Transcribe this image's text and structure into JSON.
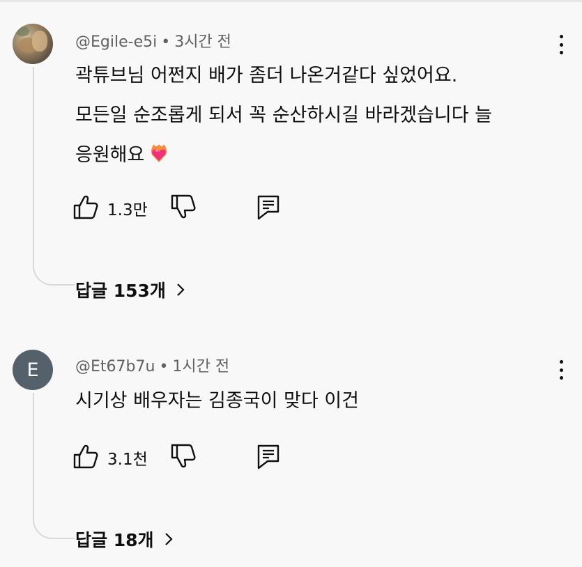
{
  "comments": [
    {
      "author": "@Egile-e5i",
      "separator": "•",
      "time": "3시간 전",
      "lines": [
        "곽튜브님 어쩐지 배가 좀더 나온거같다 싶었어요.",
        "모든일 순조롭게 되서 꼭 순산하시길 바라겠습니다 늘",
        "응원해요"
      ],
      "emoji": "heart-on-fire",
      "likes": "1.3만",
      "replies_label": "답글 153개",
      "avatar_type": "photo"
    },
    {
      "author": "@Et67b7u",
      "separator": "•",
      "time": "1시간 전",
      "lines": [
        "시기상 배우자는 김종국이 맞다 이건"
      ],
      "likes": "3.1천",
      "replies_label": "답글 18개",
      "avatar_type": "letter",
      "avatar_letter": "E",
      "avatar_color": "#55616a"
    }
  ],
  "icons": {
    "like": "thumbs-up-icon",
    "dislike": "thumbs-down-icon",
    "reply": "comment-icon",
    "more": "more-vertical-icon",
    "replies": "chevron-right-icon"
  }
}
